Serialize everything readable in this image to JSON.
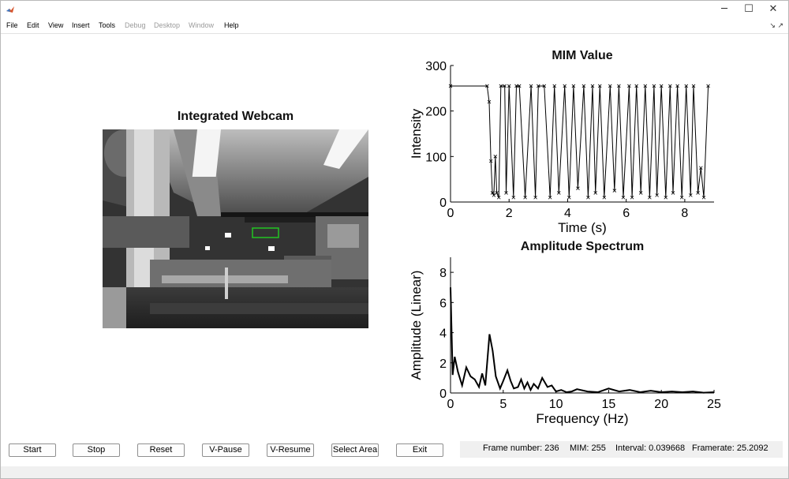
{
  "window": {
    "controls": {
      "minimize": "─",
      "maximize": "☐",
      "close": "✕"
    }
  },
  "menu": {
    "items": [
      {
        "label": "File",
        "enabled": true
      },
      {
        "label": "Edit",
        "enabled": true
      },
      {
        "label": "View",
        "enabled": true
      },
      {
        "label": "Insert",
        "enabled": true
      },
      {
        "label": "Tools",
        "enabled": true
      },
      {
        "label": "Debug",
        "enabled": false
      },
      {
        "label": "Desktop",
        "enabled": false
      },
      {
        "label": "Window",
        "enabled": false
      },
      {
        "label": "Help",
        "enabled": true
      }
    ],
    "dock_arrows": "↘ ↗"
  },
  "webcam": {
    "title": "Integrated Webcam"
  },
  "buttons": {
    "start": "Start",
    "stop": "Stop",
    "reset": "Reset",
    "vpause": "V-Pause",
    "vresume": "V-Resume",
    "select_area": "Select Area",
    "exit": "Exit"
  },
  "status": {
    "frame": "Frame number: 236",
    "mim": "MIM: 255",
    "interval": "Interval: 0.039668",
    "framerate": "Framerate: 25.2092"
  },
  "colors": {
    "selection_box": "#22c422",
    "plot_line": "#000000"
  },
  "chart_data": [
    {
      "type": "line",
      "title": "MIM Value",
      "xlabel": "Time (s)",
      "ylabel": "Intensity",
      "xlim": [
        0,
        9
      ],
      "ylim": [
        0,
        300
      ],
      "xticks": [
        0,
        2,
        4,
        6,
        8
      ],
      "yticks": [
        0,
        100,
        200,
        300
      ],
      "marker": "x",
      "series": [
        {
          "x": [
            0,
            1.25,
            1.32,
            1.38,
            1.43,
            1.48,
            1.53,
            1.58,
            1.65,
            1.72,
            1.85,
            1.9,
            2.0,
            2.15,
            2.25,
            2.35,
            2.55,
            2.75,
            2.9,
            3.0,
            3.2,
            3.4,
            3.55,
            3.7,
            3.9,
            4.05,
            4.2,
            4.35,
            4.55,
            4.7,
            4.85,
            4.95,
            5.1,
            5.25,
            5.45,
            5.6,
            5.75,
            5.9,
            6.1,
            6.2,
            6.35,
            6.5,
            6.65,
            6.8,
            6.95,
            7.05,
            7.2,
            7.35,
            7.5,
            7.6,
            7.75,
            7.9,
            8.05,
            8.2,
            8.3,
            8.45,
            8.55,
            8.65,
            8.8
          ],
          "y": [
            255,
            255,
            220,
            90,
            20,
            15,
            100,
            20,
            10,
            255,
            255,
            20,
            255,
            10,
            255,
            255,
            10,
            255,
            10,
            255,
            255,
            10,
            255,
            20,
            255,
            10,
            255,
            30,
            255,
            10,
            255,
            20,
            255,
            10,
            255,
            25,
            255,
            10,
            255,
            10,
            255,
            20,
            255,
            10,
            255,
            15,
            255,
            10,
            255,
            20,
            255,
            10,
            255,
            15,
            255,
            20,
            75,
            10,
            255
          ]
        }
      ]
    },
    {
      "type": "line",
      "title": "Amplitude Spectrum",
      "xlabel": "Frequency (Hz)",
      "ylabel": "Amplitude (Linear)",
      "xlim": [
        0,
        25
      ],
      "ylim": [
        0,
        9
      ],
      "xticks": [
        0,
        5,
        10,
        15,
        20,
        25
      ],
      "yticks": [
        0,
        2,
        4,
        6,
        8
      ],
      "series": [
        {
          "x": [
            0,
            0.2,
            0.4,
            0.7,
            1.1,
            1.5,
            1.9,
            2.3,
            2.7,
            3.0,
            3.3,
            3.7,
            4.0,
            4.3,
            4.7,
            5.0,
            5.4,
            5.7,
            6.0,
            6.4,
            6.7,
            7.0,
            7.3,
            7.6,
            7.9,
            8.3,
            8.7,
            9.2,
            9.6,
            10.0,
            10.5,
            11.0,
            11.5,
            12.0,
            13.0,
            14.0,
            15.0,
            16.0,
            17.0,
            18.0,
            19.0,
            20.0,
            21.0,
            22.0,
            23.0,
            24.0,
            25.0
          ],
          "y": [
            7.0,
            1.2,
            2.4,
            1.4,
            0.5,
            1.7,
            1.1,
            0.9,
            0.4,
            1.3,
            0.5,
            3.9,
            2.8,
            1.1,
            0.3,
            0.8,
            1.5,
            0.8,
            0.3,
            0.4,
            0.9,
            0.3,
            0.7,
            0.2,
            0.6,
            0.3,
            1.0,
            0.4,
            0.5,
            0.1,
            0.2,
            0.05,
            0.1,
            0.25,
            0.1,
            0.05,
            0.3,
            0.1,
            0.2,
            0.05,
            0.15,
            0.05,
            0.1,
            0.05,
            0.1,
            0.02,
            0.05
          ]
        }
      ]
    }
  ]
}
